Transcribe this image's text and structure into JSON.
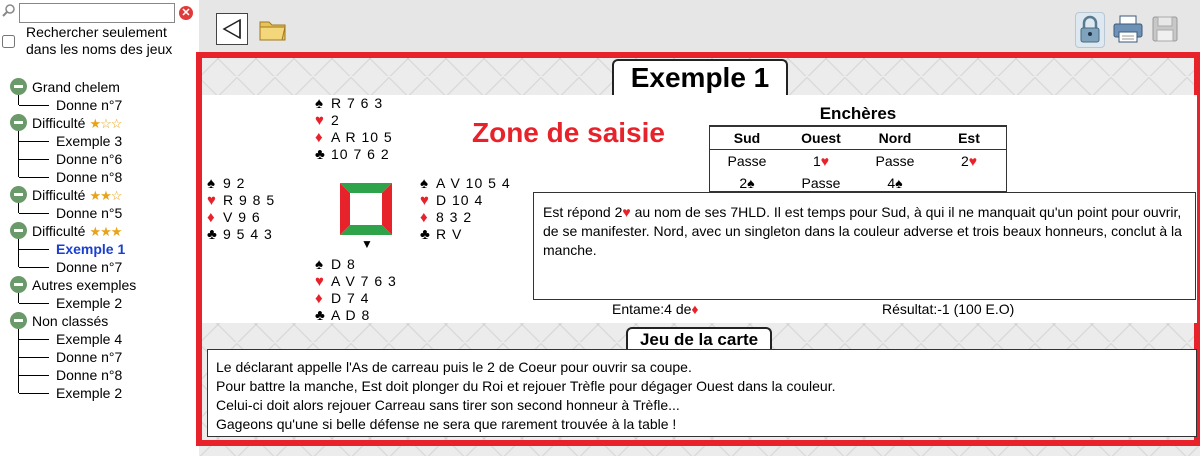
{
  "sidebar": {
    "search_placeholder": "",
    "clear_icon": "close-icon",
    "only_names_label": "Rechercher seulement dans les noms des jeux",
    "tree": [
      {
        "label": "Grand chelem",
        "stars": "",
        "children": [
          "Donne n°7"
        ]
      },
      {
        "label": "Difficulté",
        "stars": "★☆☆",
        "children": [
          "Exemple 3",
          "Donne n°6",
          "Donne n°8"
        ]
      },
      {
        "label": "Difficulté",
        "stars": "★★☆",
        "children": [
          "Donne n°5"
        ]
      },
      {
        "label": "Difficulté",
        "stars": "★★★",
        "children": [
          "Exemple 1",
          "Donne n°7"
        ]
      },
      {
        "label": "Autres exemples",
        "stars": "",
        "children": [
          "Exemple 2"
        ]
      },
      {
        "label": "Non classés",
        "stars": "",
        "children": [
          "Exemple 4",
          "Donne n°7",
          "Donne n°8",
          "Exemple 2"
        ]
      }
    ],
    "selected": "Exemple 1"
  },
  "toolbar": {
    "icons": [
      "back-icon",
      "folder-icon",
      "lock-icon",
      "print-icon",
      "save-icon"
    ]
  },
  "main": {
    "title": "Exemple 1",
    "zone_label": "Zone de saisie",
    "hands": {
      "north": {
        "S": "R 7 6 3",
        "H": "2",
        "D": "A R 10 5",
        "C": "10 7 6 2"
      },
      "west": {
        "S": "9 2",
        "H": "R 9 8 5",
        "D": "V 9 6",
        "C": "9 5 4 3"
      },
      "east": {
        "S": "A V 10 5 4",
        "H": "D 10 4",
        "D": "8 3 2",
        "C": "R V"
      },
      "south": {
        "S": "D 8",
        "H": "A V 7 6 3",
        "D": "D 7 4",
        "C": "A D 8"
      }
    },
    "bidding": {
      "title": "Enchères",
      "headers": [
        "Sud",
        "Ouest",
        "Nord",
        "Est"
      ],
      "rows": [
        [
          "Passe",
          "1♥",
          "Passe",
          "2♥"
        ],
        [
          "2♠",
          "Passe",
          "4♠",
          ""
        ]
      ]
    },
    "comment": "Est répond 2♥ au nom de ses 7HLD. Il est temps pour Sud, à qui il ne manquait qu'un point pour ouvrir, de se manifester. Nord, avec un singleton dans la couleur adverse et trois beaux honneurs, conclut à la manche.",
    "lead_label": "Entame:4 de",
    "lead_suit": "♦",
    "result": "Résultat:-1 (100 E.O)",
    "play_title": "Jeu de la carte",
    "play_lines": [
      "Le déclarant appelle l'As de carreau puis le 2 de Coeur pour ouvrir sa coupe.",
      "Pour battre la manche, Est doit plonger du Roi et rejouer Trèfle pour dégager Ouest dans la couleur.",
      "Celui-ci doit alors rejouer Carreau sans tirer son second honneur à Trèfle...",
      "Gageons qu'une si belle défense ne sera que rarement trouvée à la table !"
    ]
  },
  "colors": {
    "accent": "#e8222a",
    "selected": "#1a3fd0",
    "star": "#e8a317",
    "tree_button": "#6a9a6a"
  }
}
